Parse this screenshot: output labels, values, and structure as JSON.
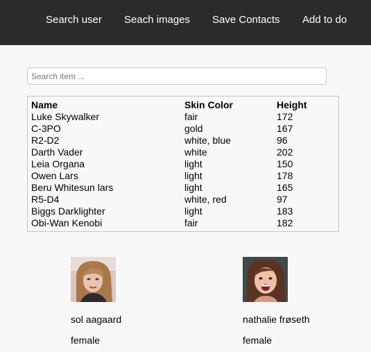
{
  "nav": {
    "items": [
      {
        "label": "Search user"
      },
      {
        "label": "Seach images"
      },
      {
        "label": "Save Contacts"
      },
      {
        "label": "Add to do"
      }
    ]
  },
  "search": {
    "placeholder": "Search item ...",
    "value": ""
  },
  "table": {
    "headers": [
      "Name",
      "Skin Color",
      "Height"
    ],
    "rows": [
      [
        "Luke Skywalker",
        "fair",
        "172"
      ],
      [
        "C-3PO",
        "gold",
        "167"
      ],
      [
        "R2-D2",
        "white, blue",
        "96"
      ],
      [
        "Darth Vader",
        "white",
        "202"
      ],
      [
        "Leia Organa",
        "light",
        "150"
      ],
      [
        "Owen Lars",
        "light",
        "178"
      ],
      [
        "Beru Whitesun lars",
        "light",
        "165"
      ],
      [
        "R5-D4",
        "white, red",
        "97"
      ],
      [
        "Biggs Darklighter",
        "light",
        "183"
      ],
      [
        "Obi-Wan Kenobi",
        "fair",
        "182"
      ]
    ]
  },
  "users": [
    {
      "name": "sol aagaard",
      "gender": "female"
    },
    {
      "name": "nathalie frøseth",
      "gender": "female"
    }
  ]
}
